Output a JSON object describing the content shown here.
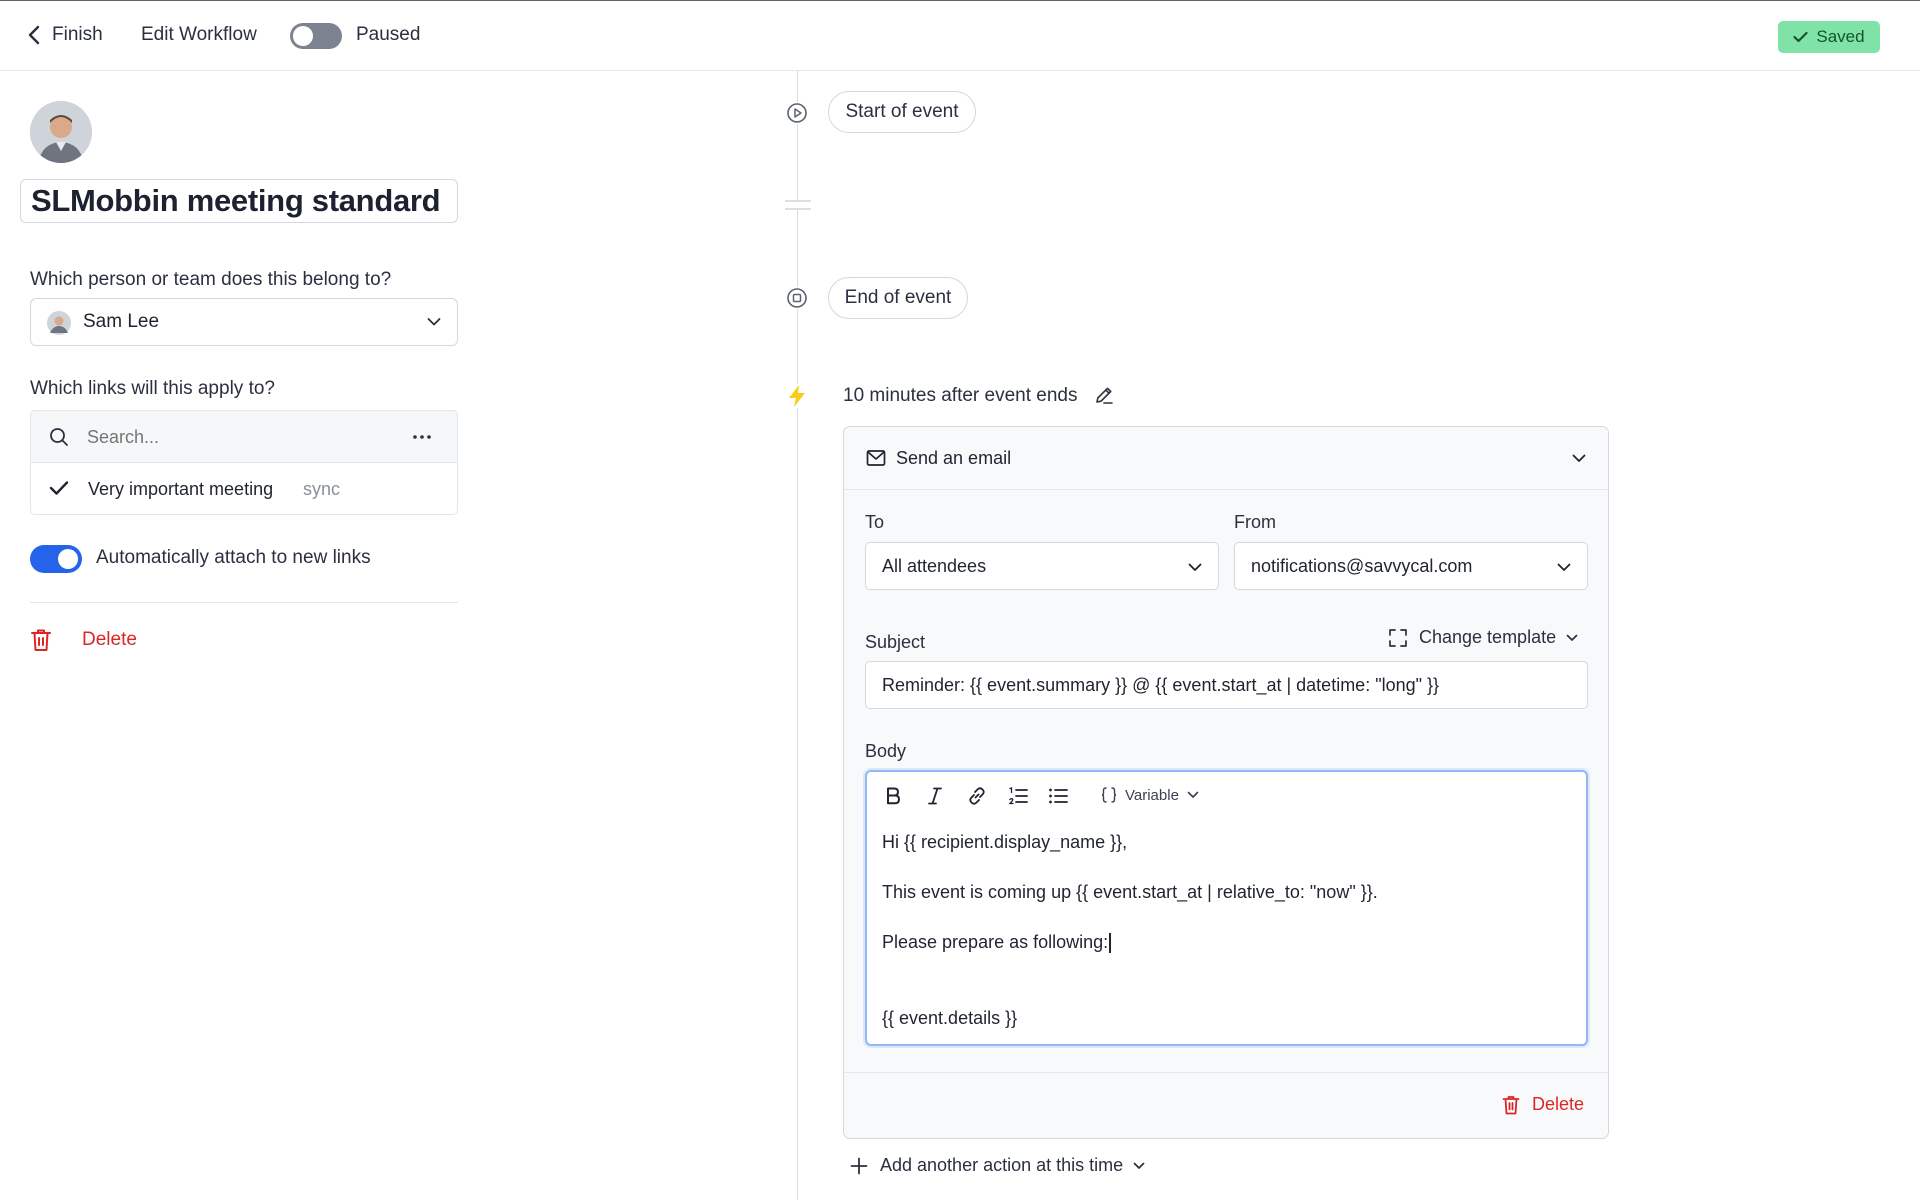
{
  "topbar": {
    "finish_label": "Finish",
    "edit_workflow_label": "Edit Workflow",
    "status_label": "Paused",
    "saved_label": "Saved"
  },
  "workflow": {
    "title": "SLMobbin meeting standard",
    "owner_question": "Which person or team does this belong to?",
    "owner_value": "Sam Lee",
    "links_question": "Which links will this apply to?",
    "search_placeholder": "Search...",
    "links": [
      {
        "name": "Very important meeting",
        "tag": "sync"
      }
    ],
    "auto_attach_label": "Automatically attach to new links",
    "delete_label": "Delete"
  },
  "timeline": {
    "start_label": "Start of event",
    "end_label": "End of event",
    "trigger_label": "10 minutes after event ends"
  },
  "action": {
    "title": "Send an email",
    "to_label": "To",
    "to_value": "All attendees",
    "from_label": "From",
    "from_value": "notifications@savvycal.com",
    "subject_label": "Subject",
    "change_template_label": "Change template",
    "subject_value": "Reminder: {{ event.summary }} @ {{ event.start_at | datetime: \"long\" }}",
    "body_label": "Body",
    "variable_label": "Variable",
    "body_lines": [
      "Hi {{ recipient.display_name }},",
      "This event is coming up {{ event.start_at | relative_to: \"now\" }}.",
      "Please prepare as following:",
      "{{ event.details }}"
    ],
    "delete_label": "Delete",
    "add_action_label": "Add another action at this time"
  },
  "colors": {
    "accent": "#2563eb",
    "saved_bg": "#7fe3a8",
    "danger": "#dc2626",
    "trigger": "#facc15"
  }
}
